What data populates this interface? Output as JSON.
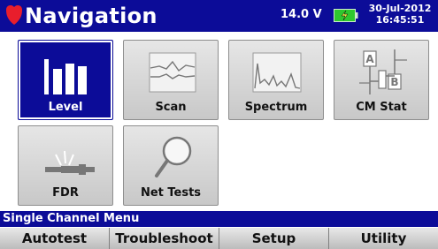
{
  "header": {
    "title": "Navigation",
    "voltage": "14.0 V",
    "date": "30-Jul-2012",
    "time": "16:45:51",
    "battery_icon": "battery-charging-icon",
    "logo_icon": "shield-icon"
  },
  "tiles": [
    {
      "label": "Level",
      "icon": "level-bars-icon",
      "selected": true
    },
    {
      "label": "Scan",
      "icon": "scan-waveform-icon",
      "selected": false
    },
    {
      "label": "Spectrum",
      "icon": "spectrum-graph-icon",
      "selected": false
    },
    {
      "label": "CM Stat",
      "icon": "cm-stat-icon",
      "selected": false
    },
    {
      "label": "FDR",
      "icon": "fdr-cable-icon",
      "selected": false
    },
    {
      "label": "Net Tests",
      "icon": "magnifier-icon",
      "selected": false
    }
  ],
  "status": {
    "menu_title": "Single Channel Menu"
  },
  "softkeys": [
    "Autotest",
    "Troubleshoot",
    "Setup",
    "Utility"
  ],
  "colors": {
    "header_bg": "#0c0c98",
    "tile_bg": "#d6d6d6",
    "selected_bg": "#0c0c98",
    "accent_red": "#e81e2c",
    "battery_green": "#2ec82e"
  }
}
